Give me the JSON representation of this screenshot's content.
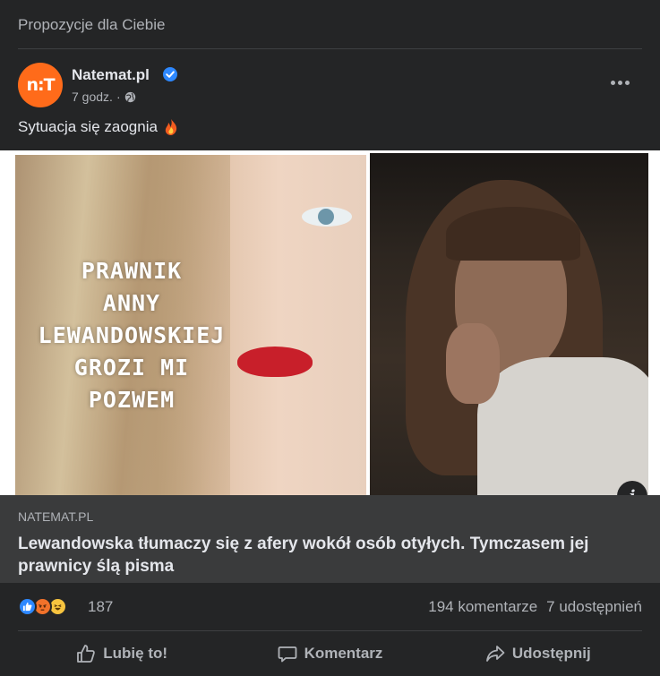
{
  "suggest": {
    "header": "Propozycje dla Ciebie"
  },
  "post": {
    "author": "Natemat.pl",
    "avatar_text": "n:T",
    "time": "7 godz.",
    "visibility_icon": "globe-icon",
    "text": "Sytuacja się zaognia",
    "emoji_icon": "fire-icon"
  },
  "image": {
    "headline_lines": [
      "PRAWNIK",
      "ANNY",
      "LEWANDOWSKIEJ",
      "GROZI MI",
      "POZWEM"
    ]
  },
  "link": {
    "domain": "NATEMAT.PL",
    "title": "Lewandowska tłumaczy się z afery wokół osób otyłych. Tymczasem jej prawnicy ślą pisma"
  },
  "stats": {
    "reaction_count": "187",
    "comments": "194 komentarze",
    "shares": "7 udostępnień"
  },
  "actions": {
    "like": "Lubię to!",
    "comment": "Komentarz",
    "share": "Udostępnij"
  },
  "colors": {
    "background": "#242526",
    "link_preview_bg": "#3a3b3c",
    "text_primary": "#e4e6eb",
    "text_secondary": "#b0b3b8",
    "verified_blue": "#2d88ff",
    "brand_orange": "#ff6b1a"
  }
}
